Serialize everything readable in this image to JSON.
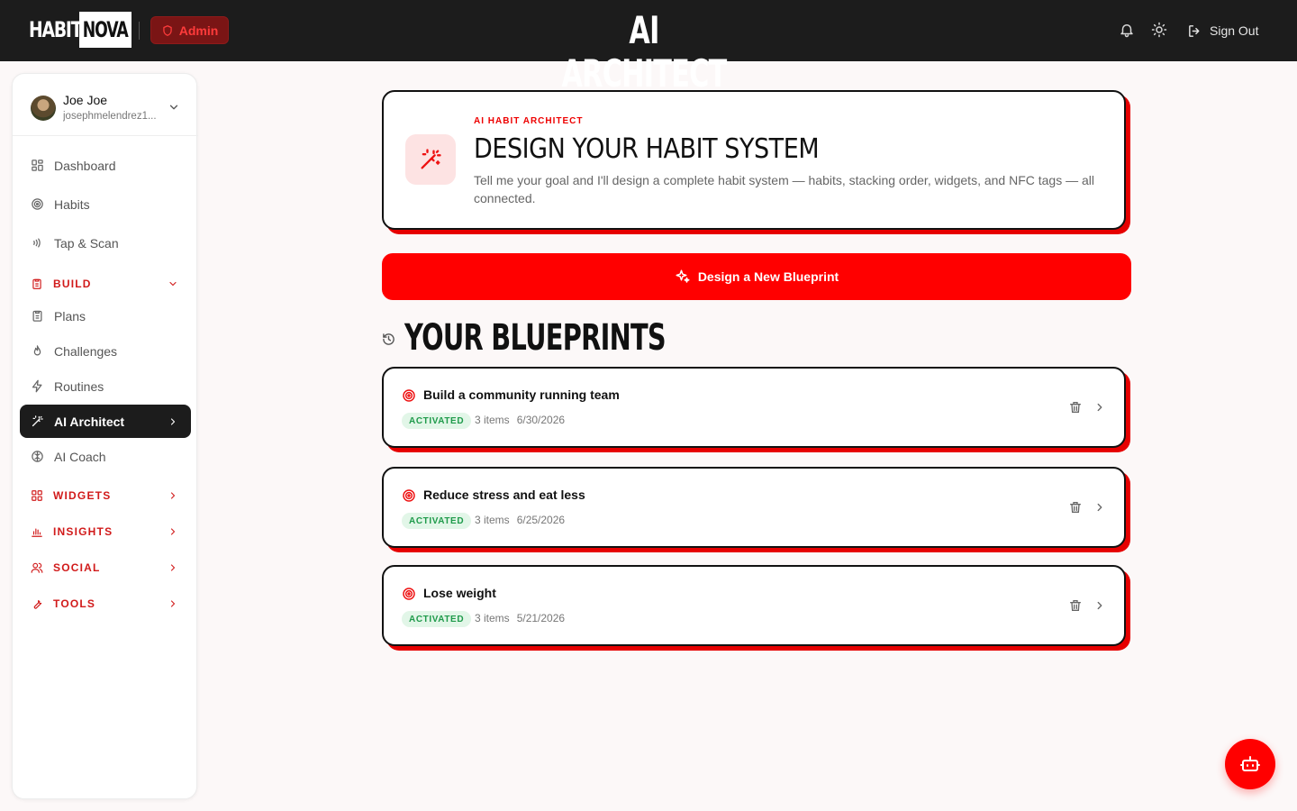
{
  "header": {
    "logo_part1": "HABIT",
    "logo_part2": "NOVA",
    "admin_label": "Admin",
    "title": "AI ARCHITECT",
    "signout_label": "Sign Out"
  },
  "user": {
    "name": "Joe Joe",
    "email": "josephmelendrez1..."
  },
  "nav": {
    "dashboard": "Dashboard",
    "habits": "Habits",
    "tap_scan": "Tap & Scan",
    "build": "BUILD",
    "plans": "Plans",
    "challenges": "Challenges",
    "routines": "Routines",
    "ai_architect": "AI Architect",
    "ai_coach": "AI Coach",
    "widgets": "WIDGETS",
    "insights": "INSIGHTS",
    "social": "SOCIAL",
    "tools": "TOOLS"
  },
  "hero": {
    "kicker": "AI HABIT ARCHITECT",
    "title": "DESIGN YOUR HABIT SYSTEM",
    "description": "Tell me your goal and I'll design a complete habit system — habits, stacking order, widgets, and NFC tags — all connected."
  },
  "cta_label": "Design a New Blueprint",
  "blueprints_title": "YOUR BLUEPRINTS",
  "blueprints": [
    {
      "title": "Build a community running team",
      "status": "ACTIVATED",
      "items": "3 items",
      "date": "6/30/2026"
    },
    {
      "title": "Reduce stress and eat less",
      "status": "ACTIVATED",
      "items": "3 items",
      "date": "6/25/2026"
    },
    {
      "title": "Lose weight",
      "status": "ACTIVATED",
      "items": "3 items",
      "date": "5/21/2026"
    }
  ],
  "colors": {
    "accent": "#ff0000",
    "header_bg": "#1c1c1c",
    "badge_green": "#1e9a4a"
  }
}
